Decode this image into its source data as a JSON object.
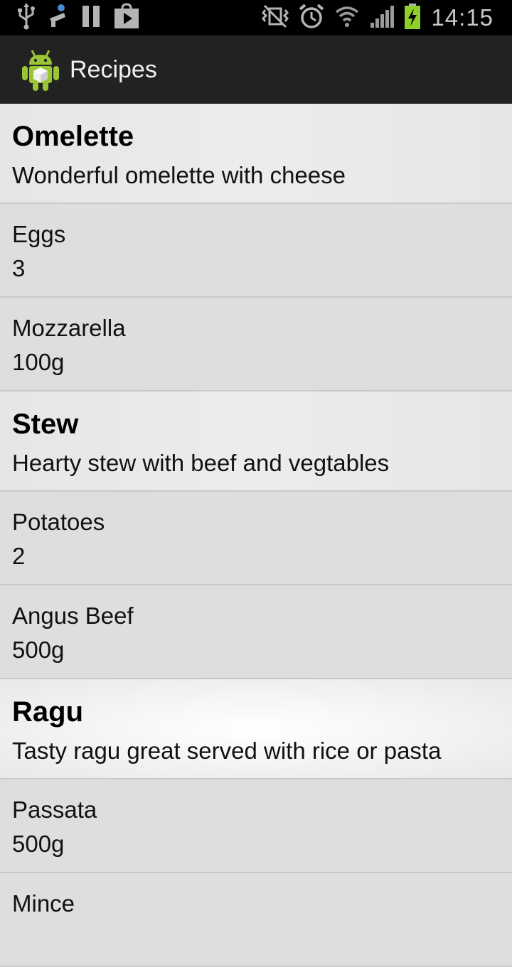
{
  "status_bar": {
    "time": "14:15",
    "icons_left": [
      "usb-icon",
      "notification-icon",
      "pause-icon",
      "play-store-icon"
    ],
    "icons_right": [
      "vibrate-icon",
      "alarm-icon",
      "wifi-icon",
      "signal-icon",
      "battery-charging-icon"
    ],
    "battery_color": "#8ecf2a"
  },
  "action_bar": {
    "title": "Recipes",
    "logo_icon": "android-icon",
    "logo_color": "#9ac636"
  },
  "recipes": [
    {
      "name": "Omelette",
      "description": "Wonderful omelette with cheese",
      "ingredients": [
        {
          "name": "Eggs",
          "quantity": "3"
        },
        {
          "name": "Mozzarella",
          "quantity": "100g"
        }
      ]
    },
    {
      "name": "Stew",
      "description": "Hearty stew with beef and vegtables",
      "ingredients": [
        {
          "name": "Potatoes",
          "quantity": "2"
        },
        {
          "name": "Angus Beef",
          "quantity": "500g"
        }
      ]
    },
    {
      "name": "Ragu",
      "description": "Tasty ragu great served with rice or pasta",
      "ingredients": [
        {
          "name": "Passata",
          "quantity": "500g"
        },
        {
          "name": "Mince",
          "quantity": ""
        }
      ]
    }
  ]
}
